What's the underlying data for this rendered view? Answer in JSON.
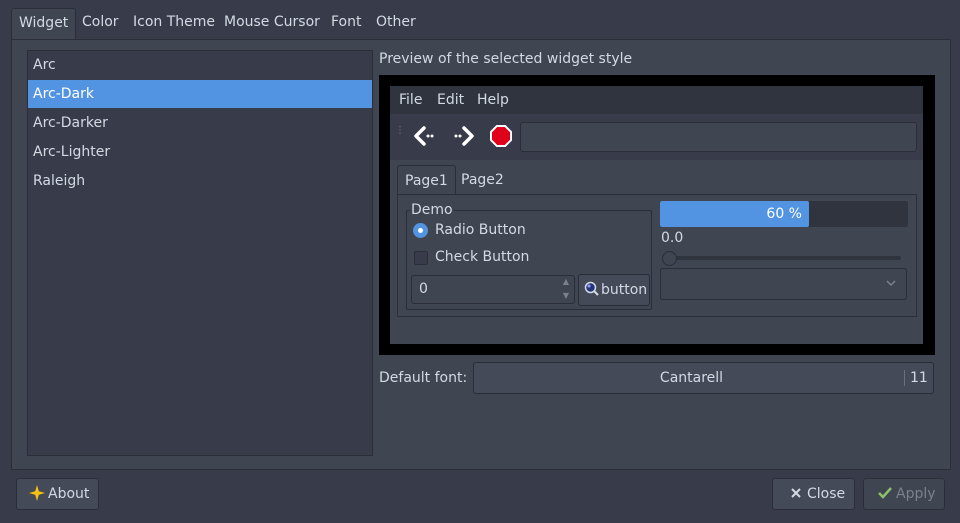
{
  "tabs": [
    "Widget",
    "Color",
    "Icon Theme",
    "Mouse Cursor",
    "Font",
    "Other"
  ],
  "theme_list": {
    "items": [
      "Arc",
      "Arc-Dark",
      "Arc-Darker",
      "Arc-Lighter",
      "Raleigh"
    ],
    "selected": "Arc-Dark"
  },
  "preview": {
    "label": "Preview of the selected widget style",
    "menus": [
      "File",
      "Edit",
      "Help"
    ],
    "toolbar_icons": [
      "back-arrow-icon",
      "forward-arrow-icon",
      "stop-icon"
    ],
    "notebook_tabs": [
      "Page1",
      "Page2"
    ],
    "frame_label": "Demo",
    "radio_label": "Radio Button",
    "check_label": "Check Button",
    "spin_value": "0",
    "button_label": "button",
    "progress_text": "60 %",
    "progress_fraction": 0.6,
    "scale_value": "0.0"
  },
  "font": {
    "label": "Default font:",
    "name": "Cantarell",
    "size": "11"
  },
  "buttons": {
    "about": "About",
    "close": "Close",
    "apply": "Apply"
  },
  "colors": {
    "accent": "#5294e2",
    "background": "#383c4a",
    "panel": "#404552",
    "stop_red": "#e0001a"
  }
}
